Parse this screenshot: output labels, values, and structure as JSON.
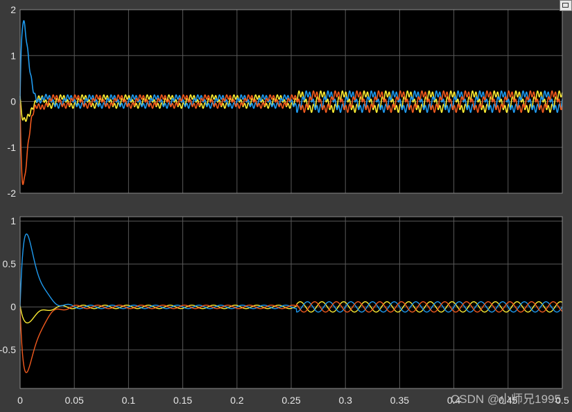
{
  "window": {
    "background": "#3a3a3a"
  },
  "colors": {
    "plot_bg": "#000000",
    "grid": "#5a5a5a",
    "tick_text": "#e8e8e8",
    "series_a": "#1f9bf0",
    "series_b": "#f25a1e",
    "series_c": "#ffee33"
  },
  "watermark": "CSDN @小师兄1995",
  "icons": {
    "corner": "restore-icon"
  },
  "chart_data": [
    {
      "type": "line",
      "xlim": [
        0,
        0.5
      ],
      "ylim": [
        -2,
        2
      ],
      "grid": true,
      "x_ticks": [
        0,
        0.05,
        0.1,
        0.15,
        0.2,
        0.25,
        0.3,
        0.35,
        0.4,
        0.45,
        0.5
      ],
      "y_ticks": [
        -2,
        -1,
        0,
        1,
        2
      ],
      "y_tick_labels": [
        "-2",
        "-1",
        "0",
        "1",
        "2"
      ],
      "x_tick_labels_shown": false,
      "signal": {
        "frequency_hz": 50,
        "phases_deg": [
          0,
          -120,
          120
        ],
        "ripple_hz": 300,
        "ripple_amplitude": 0.05,
        "step_time": 0.255,
        "amplitude_before": 0.1,
        "amplitude_after": 0.17,
        "transient_peaks": [
          1.65,
          -1.7,
          -0.4
        ],
        "transient_peak_time": 0.003
      },
      "series": [
        {
          "values": [
            0,
            1.65,
            0.3,
            0.1,
            0.1,
            0.17
          ]
        },
        {
          "values": [
            0,
            -1.7,
            -0.2,
            -0.1,
            -0.1,
            -0.17
          ]
        },
        {
          "values": [
            0,
            -0.4,
            0.1,
            0.1,
            0.1,
            0.17
          ]
        }
      ]
    },
    {
      "type": "line",
      "xlim": [
        0,
        0.5
      ],
      "ylim": [
        -0.95,
        1.05
      ],
      "grid": true,
      "x_ticks": [
        0,
        0.05,
        0.1,
        0.15,
        0.2,
        0.25,
        0.3,
        0.35,
        0.4,
        0.45,
        0.5
      ],
      "x_tick_labels": [
        "0",
        "0.05",
        "0.1",
        "0.15",
        "0.2",
        "0.25",
        "0.3",
        "0.35",
        "0.4",
        "0.45",
        "0.5"
      ],
      "y_ticks": [
        -0.5,
        0,
        0.5,
        1
      ],
      "y_tick_labels": [
        "-0.5",
        "0",
        "0.5",
        "1"
      ],
      "signal": {
        "frequency_hz": 50,
        "phases_deg": [
          0,
          -120,
          120
        ],
        "step_time": 0.255,
        "amplitude_before": 0.02,
        "amplitude_after": 0.06,
        "transient_peaks": [
          0.83,
          -0.76,
          -0.17
        ],
        "transient_peak_time": 0.006
      },
      "series": [
        {
          "values": [
            0,
            0.83,
            0.1,
            0.02,
            0.02,
            0.06
          ]
        },
        {
          "values": [
            0,
            -0.76,
            -0.1,
            -0.02,
            -0.02,
            -0.06
          ]
        },
        {
          "values": [
            0,
            -0.17,
            0.02,
            0.02,
            0.02,
            0.06
          ]
        }
      ]
    }
  ]
}
